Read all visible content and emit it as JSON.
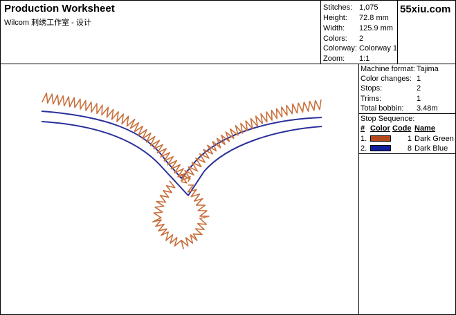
{
  "header": {
    "title": "Production Worksheet",
    "subtitle": "Wilcom 刺绣工作室 - 设计",
    "logo": "55xiu.com"
  },
  "stats": [
    {
      "label": "Stitches:",
      "value": "1,075"
    },
    {
      "label": "Height:",
      "value": "72.8 mm"
    },
    {
      "label": "Width:",
      "value": "125.9 mm"
    },
    {
      "label": "Colors:",
      "value": "2"
    },
    {
      "label": "Colorway:",
      "value": "Colorway 1"
    },
    {
      "label": "Zoom:",
      "value": "1:1"
    }
  ],
  "machine": [
    {
      "label": "Machine format:",
      "value": "Tajima"
    },
    {
      "label": "Color changes:",
      "value": "1"
    },
    {
      "label": "Stops:",
      "value": "2"
    },
    {
      "label": "Trims:",
      "value": "1"
    },
    {
      "label": "Total bobbin:",
      "value": "3.48m"
    }
  ],
  "stop_sequence": {
    "title": "Stop Sequence:",
    "headers": {
      "num": "#",
      "color": "Color",
      "code": "Code",
      "name": "Name"
    },
    "rows": [
      {
        "index": "1.",
        "swatch": "#b5471b",
        "code": "1",
        "name": "Dark Green"
      },
      {
        "index": "2.",
        "swatch": "#0f1e9c",
        "code": "8",
        "name": "Dark Blue"
      }
    ]
  },
  "design": {
    "colors": {
      "satin": "#c8703c",
      "satin_dark": "#8a4a28",
      "run": "#2b2f9a"
    }
  }
}
